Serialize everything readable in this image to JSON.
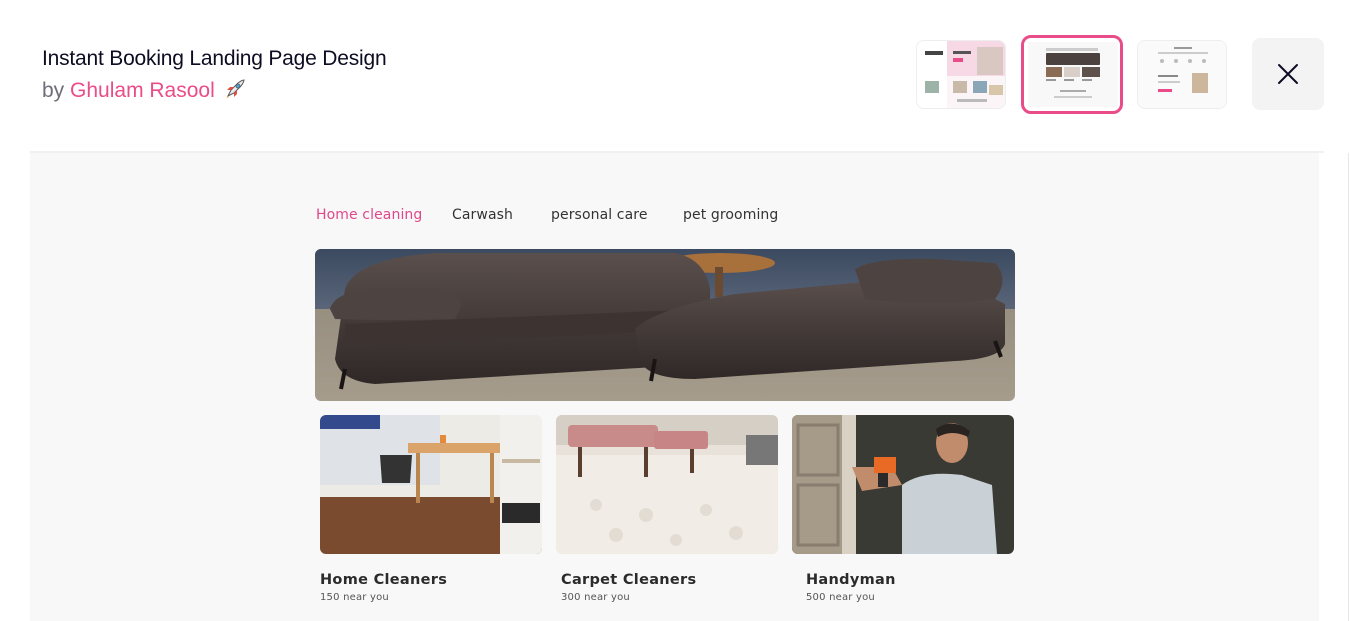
{
  "header": {
    "title": "Instant Booking Landing Page Design",
    "by_prefix": "by",
    "author": "Ghulam Rasool",
    "author_icon": "rocket-icon"
  },
  "thumbnails": [
    {
      "name": "thumbnail-1",
      "selected": false
    },
    {
      "name": "thumbnail-2",
      "selected": true
    },
    {
      "name": "thumbnail-3",
      "selected": false
    }
  ],
  "close_icon": "close-icon",
  "shot": {
    "nav": [
      "Home cleaning",
      "Carwash",
      "personal care",
      "pet grooming"
    ],
    "active_nav": "Home cleaning",
    "cards": [
      {
        "title": "Home Cleaners",
        "sub": "150 near you"
      },
      {
        "title": "Carpet Cleaners",
        "sub": "300 near you"
      },
      {
        "title": "Handyman",
        "sub": "500 near you"
      }
    ]
  },
  "colors": {
    "accent": "#ea4c89",
    "nav_active": "#e0488b",
    "canvas": "#f8f8f8"
  }
}
